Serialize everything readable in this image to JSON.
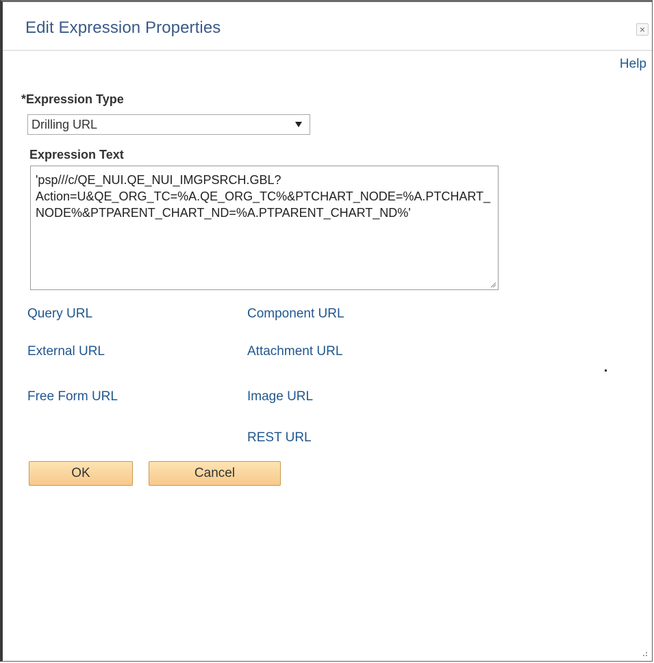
{
  "dialog": {
    "title": "Edit Expression Properties",
    "close_symbol": "×",
    "help_label": "Help"
  },
  "form": {
    "expression_type_label": "*Expression Type",
    "expression_type_value": "Drilling URL",
    "expression_text_label": "Expression Text",
    "expression_text_value": "'psp///c/QE_NUI.QE_NUI_IMGPSRCH.GBL?\nAction=U&QE_ORG_TC=%A.QE_ORG_TC%&PTCHART_NODE=%A.PTCHART_NODE%&PTPARENT_CHART_ND=%A.PTPARENT_CHART_ND%'"
  },
  "links": {
    "query_url": "Query URL",
    "component_url": "Component URL",
    "external_url": "External URL",
    "attachment_url": "Attachment URL",
    "free_form_url": "Free Form URL",
    "image_url": "Image URL",
    "rest_url": "REST URL"
  },
  "buttons": {
    "ok": "OK",
    "cancel": "Cancel"
  },
  "colors": {
    "title": "#3a5a88",
    "link": "#21578f",
    "button_fill": "#f7c98a",
    "button_border": "#c79a4d"
  },
  "icons": {
    "close": "close-icon",
    "dropdown": "chevron-down-icon",
    "resize": "resize-grip-icon"
  }
}
